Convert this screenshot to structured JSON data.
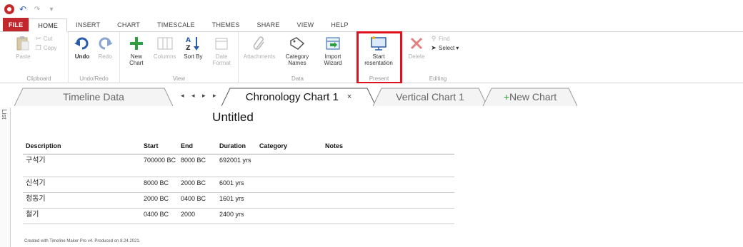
{
  "quick_access": {
    "items": [
      {
        "icon": "app-logo-icon"
      },
      {
        "icon": "undo-icon"
      },
      {
        "icon": "redo-icon"
      },
      {
        "icon": "customize-icon"
      }
    ]
  },
  "ribbon_tabs": [
    {
      "label": "FILE",
      "active": false
    },
    {
      "label": "HOME",
      "active": true
    },
    {
      "label": "INSERT",
      "active": false
    },
    {
      "label": "CHART",
      "active": false
    },
    {
      "label": "TIMESCALE",
      "active": false
    },
    {
      "label": "THEMES",
      "active": false
    },
    {
      "label": "SHARE",
      "active": false
    },
    {
      "label": "VIEW",
      "active": false
    },
    {
      "label": "HELP",
      "active": false
    }
  ],
  "ribbon": {
    "clipboard": {
      "label": "Clipboard",
      "paste": "Paste",
      "cut": "Cut",
      "copy": "Copy"
    },
    "undo_redo": {
      "label": "Undo/Redo",
      "undo": "Undo",
      "redo": "Redo"
    },
    "view": {
      "label": "View",
      "new_chart": "New Chart",
      "columns": "Columns",
      "sort_by": "Sort By",
      "date_format": "Date Format"
    },
    "data": {
      "label": "Data",
      "attachments": "Attachments",
      "category_names": "Category Names",
      "import_wizard": "Import Wizard"
    },
    "present": {
      "label": "Present",
      "start_presentation": "Start resentation"
    },
    "editing": {
      "label": "Editing",
      "delete": "Delete",
      "find": "Find",
      "select": "Select"
    }
  },
  "side_panel": {
    "label": "Chart List"
  },
  "doc_tabs": [
    {
      "label": "Timeline Data",
      "active": false
    },
    {
      "label": "Chronology Chart 1",
      "active": true,
      "close": "×"
    },
    {
      "label": "Vertical Chart 1",
      "active": false
    },
    {
      "label": "New Chart",
      "active": false
    }
  ],
  "nav_arrows": "◂ ◂ ▸ ▸",
  "chart": {
    "title": "Untitled",
    "columns": [
      "Description",
      "Start",
      "End",
      "Duration",
      "Category",
      "Notes"
    ],
    "rows": [
      {
        "description": "구석기",
        "start": "700000 BC",
        "end": "8000 BC",
        "duration": "692001 yrs",
        "category": "",
        "notes": ""
      },
      {
        "description": "신석기",
        "start": "8000 BC",
        "end": "2000 BC",
        "duration": "6001 yrs",
        "category": "",
        "notes": ""
      },
      {
        "description": "청동기",
        "start": "2000 BC",
        "end": "0400 BC",
        "duration": "1601 yrs",
        "category": "",
        "notes": ""
      },
      {
        "description": "철기",
        "start": "0400 BC",
        "end": "2000",
        "duration": "2400 yrs",
        "category": "",
        "notes": ""
      }
    ],
    "footer": "Created with Timeline Maker Pro v4. Produced on 8.24.2021."
  },
  "colors": {
    "file_tab": "#c0282d",
    "highlight": "#e0101e",
    "accent_blue": "#2a5caa",
    "accent_green": "#2e9e3e"
  }
}
